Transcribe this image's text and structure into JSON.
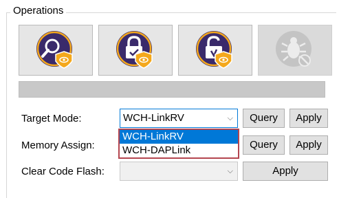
{
  "group": {
    "title": "Operations"
  },
  "operations": [
    {
      "icon": "magnifier-shield-icon"
    },
    {
      "icon": "lock-shield-icon"
    },
    {
      "icon": "unlock-shield-icon"
    },
    {
      "icon": "bug-disabled-icon"
    }
  ],
  "progress": {
    "value_percent": 0
  },
  "target_mode": {
    "label": "Target Mode:",
    "value": "WCH-LinkRV",
    "options": [
      "WCH-LinkRV",
      "WCH-DAPLink"
    ],
    "selected_index": 0
  },
  "memory_assign": {
    "label": "Memory Assign:"
  },
  "clear_code_flash": {
    "label": "Clear Code Flash:",
    "value": ""
  },
  "buttons": {
    "query": "Query",
    "apply": "Apply"
  },
  "colors": {
    "selection": "#0078d7",
    "dropdown_outline": "#b4454f",
    "icon_badge": "#f4a81c",
    "icon_circle": "#3a2a6b"
  }
}
